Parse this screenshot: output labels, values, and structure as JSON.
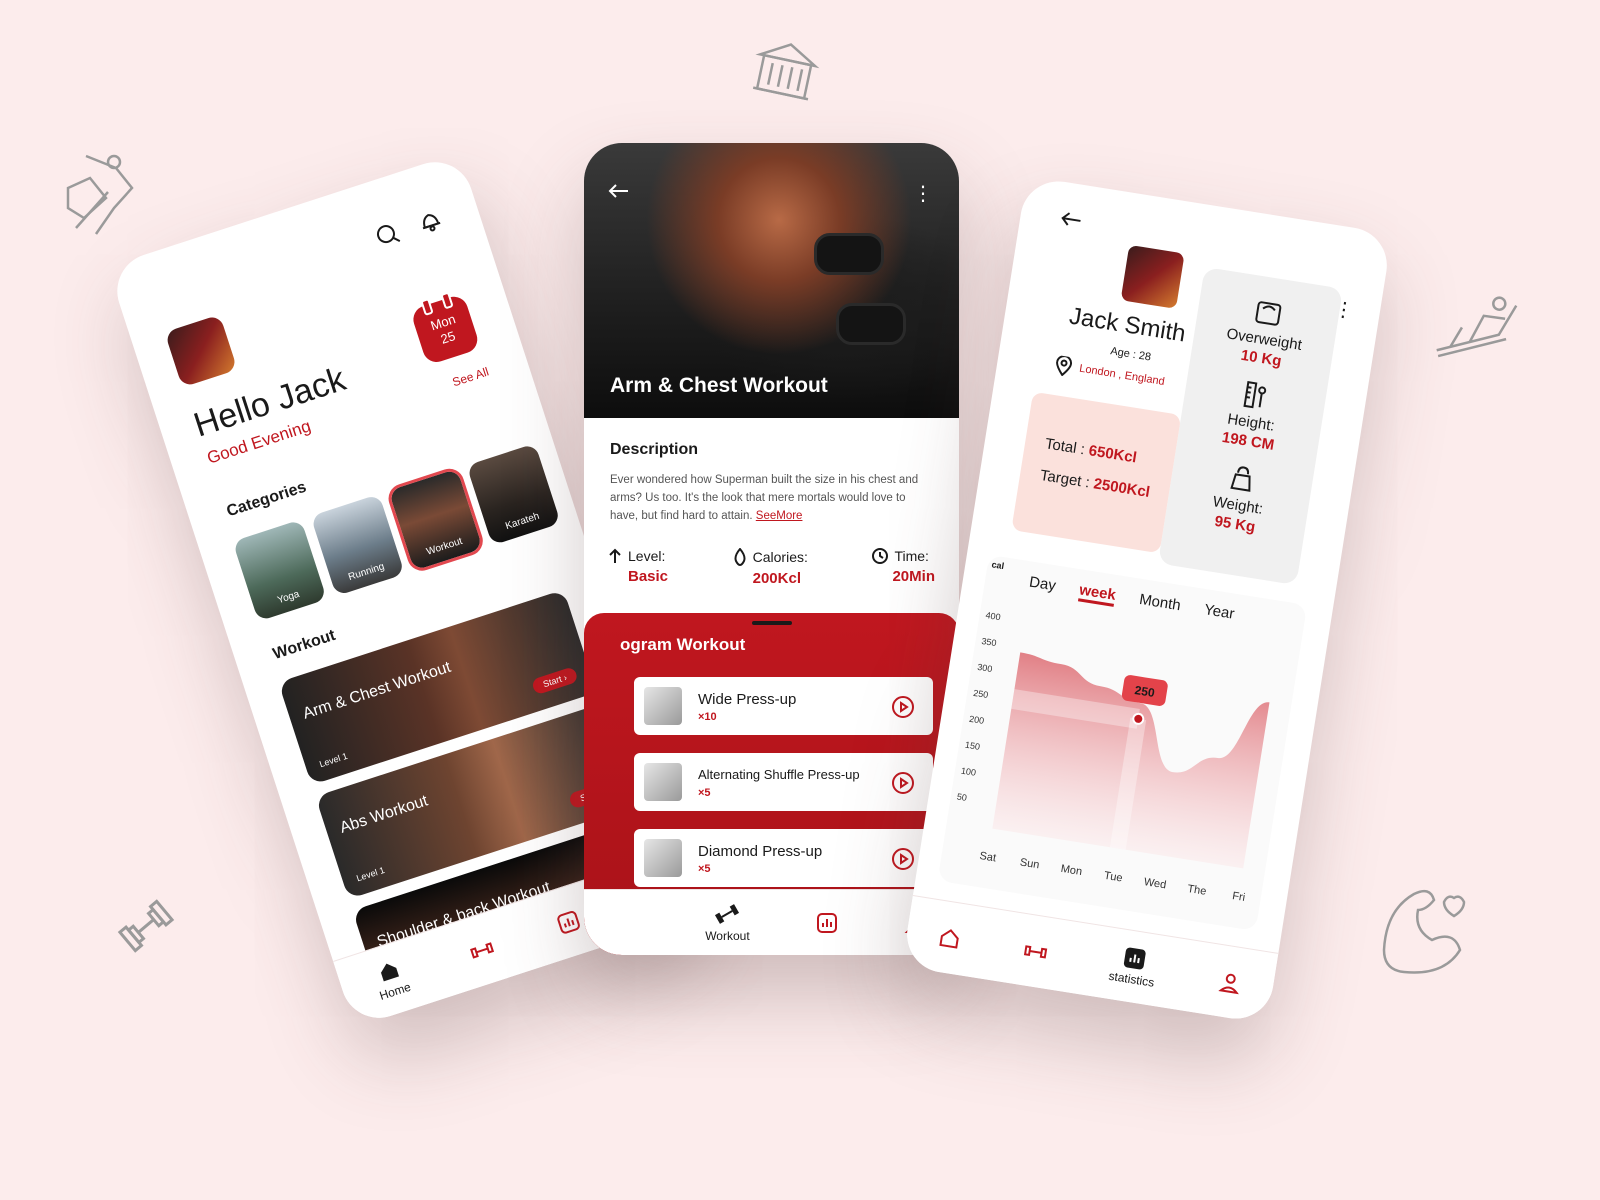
{
  "deco_icons": [
    "gym-building-icon",
    "climber-icon",
    "dumbbell-icon",
    "treadmill-icon",
    "flexed-arm-heart-icon"
  ],
  "colors": {
    "accent": "#c0171f",
    "background": "#fcecec"
  },
  "home": {
    "greeting": "Hello Jack",
    "subgreeting": "Good Evening",
    "date_day": "Mon",
    "date_num": "25",
    "see_all": "See All",
    "categories_title": "Categories",
    "categories": [
      {
        "label": "Yoga"
      },
      {
        "label": "Running"
      },
      {
        "label": "Workout"
      },
      {
        "label": "Karateh"
      }
    ],
    "workout_title": "Workout",
    "workouts": [
      {
        "title": "Arm & Chest Workout",
        "level": "Level 1",
        "start": "Start ›"
      },
      {
        "title": "Abs Workout",
        "level": "Level 1",
        "start": "Start ›"
      },
      {
        "title": "Shoulder & back Workout"
      }
    ],
    "nav": {
      "home_label": "Home"
    }
  },
  "detail": {
    "title": "Arm & Chest Workout",
    "description_title": "Description",
    "description": "Ever wondered how Superman built the size in his chest and arms? Us too. It's the look that mere mortals would love to have, but find hard to attain.",
    "see_more": "SeeMore",
    "stats": [
      {
        "label": "Level:",
        "value": "Basic"
      },
      {
        "label": "Calories:",
        "value": "200Kcl"
      },
      {
        "label": "Time:",
        "value": "20Min"
      }
    ],
    "program_title": "ogram Workout",
    "exercises": [
      {
        "name": "Wide Press-up",
        "count": "×10"
      },
      {
        "name": "Alternating Shuffle Press-up",
        "count": "×5"
      },
      {
        "name": "Diamond Press-up",
        "count": "×5"
      }
    ],
    "nav": {
      "workout_label": "Workout"
    }
  },
  "profile": {
    "name": "Jack Smith",
    "age": "Age : 28",
    "location": "London , England",
    "overweight_label": "Overweight",
    "overweight_value": "10 Kg",
    "height_label": "Height:",
    "height_value": "198 CM",
    "weight_label": "Weight:",
    "weight_value": "95 Kg",
    "total_label": "Total : ",
    "total_value": "650Kcl",
    "target_label": "Target : ",
    "target_value": "2500Kcl",
    "nav": {
      "statistics_label": "statistics"
    }
  },
  "chart_data": {
    "type": "area",
    "tabs": [
      "Day",
      "week",
      "Month",
      "Year"
    ],
    "active_tab": "week",
    "ylabel": "cal",
    "y_ticks": [
      "400",
      "350",
      "300",
      "250",
      "200",
      "150",
      "100",
      "50"
    ],
    "categories": [
      "Sat",
      "Sun",
      "Mon",
      "Tue",
      "Wed",
      "The",
      "Fri"
    ],
    "values": [
      340,
      330,
      300,
      280,
      160,
      200,
      320
    ],
    "highlight": {
      "category": "Tue",
      "value": "250"
    },
    "ylim": [
      0,
      400
    ]
  }
}
